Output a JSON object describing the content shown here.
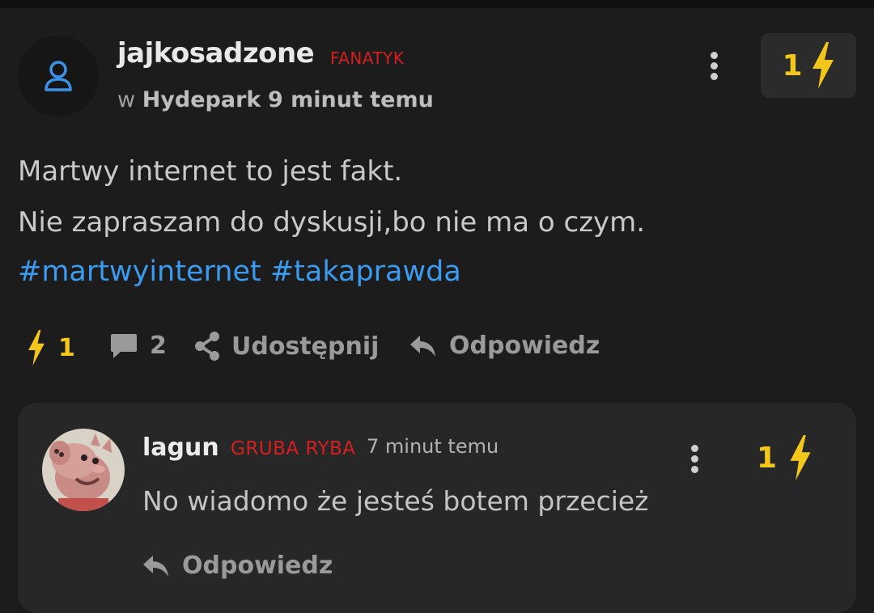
{
  "post": {
    "author": "jajkosadzone",
    "rank": "FANATYK",
    "meta_prefix": "w",
    "community": "Hydepark",
    "time": "9 minut temu",
    "vote_count": "1",
    "lines": [
      "Martwy internet to jest fakt.",
      "Nie zapraszam do dyskusji,bo nie ma o czym."
    ],
    "tags": [
      "#martwyinternet",
      "#takaprawda"
    ],
    "actions": {
      "like_count": "1",
      "comment_count": "2",
      "share_label": "Udostępnij",
      "reply_label": "Odpowiedz"
    }
  },
  "reply": {
    "author": "lagun",
    "rank": "GRUBA RYBA",
    "time": "7 minut temu",
    "text": "No wiadomo że jesteś botem przecież",
    "vote_count": "1",
    "reply_label": "Odpowiedz"
  },
  "icons": {
    "user": "user-icon",
    "menu": "vertical-dots-icon",
    "vote": "lightning-bolt-icon",
    "comment": "comment-bubble-icon",
    "share": "share-icon",
    "reply": "reply-arrow-icon"
  },
  "colors": {
    "background": "#1c1c1c",
    "card": "#272727",
    "accent_yellow": "#f3c61a",
    "rank_red": "#d81e1e",
    "link_blue": "#3b9bf0"
  }
}
